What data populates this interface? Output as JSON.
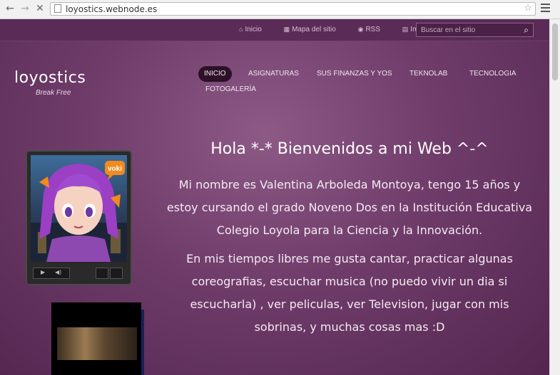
{
  "browser": {
    "url": "loyostics.webnode.es"
  },
  "topbar": {
    "links": [
      {
        "icon": "home-icon",
        "label": "Inicio"
      },
      {
        "icon": "sitemap-icon",
        "label": "Mapa del sitio"
      },
      {
        "icon": "rss-icon",
        "label": "RSS"
      },
      {
        "icon": "print-icon",
        "label": "Imprimir"
      }
    ],
    "search_placeholder": "Buscar en el sitio"
  },
  "site": {
    "logo": "loyostics",
    "tagline": "Break Free"
  },
  "nav": {
    "items": [
      {
        "label": "INICIO",
        "active": true
      },
      {
        "label": "ASIGNATURAS",
        "active": false
      },
      {
        "label": "SUS FINANZAS Y YOS",
        "active": false
      },
      {
        "label": "TEKNOLAB",
        "active": false
      },
      {
        "label": "TECNOLOGIA",
        "active": false
      },
      {
        "label": "FOTOGALERÍA",
        "active": false
      }
    ]
  },
  "avatar": {
    "badge": "voki"
  },
  "content": {
    "title": "Hola *-* Bienvenidos a mi Web ^-^",
    "paragraph1": "Mi nombre es Valentina Arboleda Montoya, tengo 15 años y estoy cursando el grado Noveno Dos en la Institución Educativa Colegio Loyola para la Ciencia y la Innovación.",
    "paragraph2": "En mis tiempos libres me gusta cantar, practicar algunas coreografias, escuchar musica (no puedo vivir un dia si escucharla) , ver peliculas, ver Television, jugar con mis sobrinas, y muchas cosas mas :D"
  },
  "colors": {
    "background": "#6f3c6a",
    "topbar": "#5a2b56",
    "active_nav": "#2c1129"
  }
}
